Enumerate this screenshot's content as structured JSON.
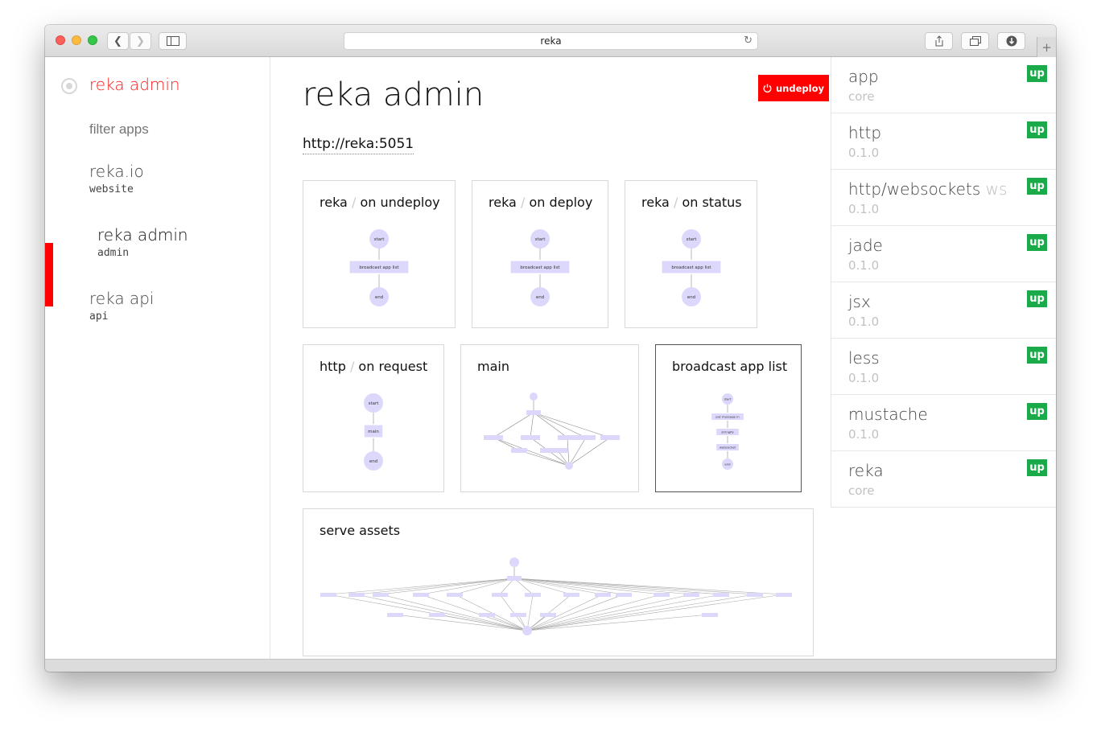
{
  "browser": {
    "url": "reka"
  },
  "sidebar": {
    "brand": "reka admin",
    "filter_placeholder": "filter apps",
    "apps": [
      {
        "name": "reka.io",
        "sub": "website"
      },
      {
        "name": "reka admin",
        "sub": "admin"
      },
      {
        "name": "reka api",
        "sub": "api"
      }
    ]
  },
  "main": {
    "title": "reka admin",
    "undeploy_label": "undeploy",
    "url": "http://reka:5051",
    "separator": "/",
    "flows": [
      {
        "prefix": "reka",
        "name": "on undeploy",
        "nodes": [
          "start",
          "broadcast app list",
          "end"
        ]
      },
      {
        "prefix": "reka",
        "name": "on deploy",
        "nodes": [
          "start",
          "broadcast app list",
          "end"
        ]
      },
      {
        "prefix": "reka",
        "name": "on status",
        "nodes": [
          "start",
          "broadcast app list",
          "end"
        ]
      },
      {
        "prefix": "http",
        "name": "on request",
        "nodes": [
          "start",
          "main",
          "end"
        ]
      },
      {
        "prefix": "",
        "name": "main",
        "nodes": []
      },
      {
        "prefix": "",
        "name": "broadcast app list",
        "nodes": [
          "start",
          "put message in",
          "stringify",
          "websocket",
          "end"
        ]
      },
      {
        "prefix": "",
        "name": "serve assets",
        "nodes": []
      }
    ]
  },
  "deps": [
    {
      "name": "app",
      "extra": "",
      "version": "core",
      "status": "up"
    },
    {
      "name": "http",
      "extra": "",
      "version": "0.1.0",
      "status": "up"
    },
    {
      "name": "http/websockets",
      "extra": "ws",
      "version": "0.1.0",
      "status": "up"
    },
    {
      "name": "jade",
      "extra": "",
      "version": "0.1.0",
      "status": "up"
    },
    {
      "name": "jsx",
      "extra": "",
      "version": "0.1.0",
      "status": "up"
    },
    {
      "name": "less",
      "extra": "",
      "version": "0.1.0",
      "status": "up"
    },
    {
      "name": "mustache",
      "extra": "",
      "version": "0.1.0",
      "status": "up"
    },
    {
      "name": "reka",
      "extra": "",
      "version": "core",
      "status": "up"
    }
  ],
  "colors": {
    "accent": "#ff0000",
    "up": "#1aaa4a",
    "node": "#dcd8fb"
  }
}
